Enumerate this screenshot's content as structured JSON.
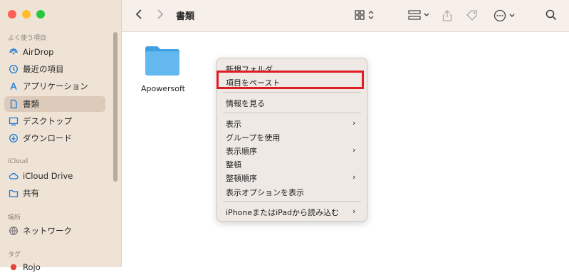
{
  "window": {
    "title": "書類"
  },
  "sidebar": {
    "sections": {
      "favorites": "よく使う項目",
      "icloud": "iCloud",
      "locations": "場所",
      "tags": "タグ"
    },
    "items": [
      {
        "label": "AirDrop",
        "icon": "airdrop-icon"
      },
      {
        "label": "最近の項目",
        "icon": "clock-icon"
      },
      {
        "label": "アプリケーション",
        "icon": "applications-icon"
      },
      {
        "label": "書類",
        "icon": "document-icon"
      },
      {
        "label": "デスクトップ",
        "icon": "desktop-icon"
      },
      {
        "label": "ダウンロード",
        "icon": "download-icon"
      },
      {
        "label": "iCloud Drive",
        "icon": "cloud-icon"
      },
      {
        "label": "共有",
        "icon": "shared-folder-icon"
      },
      {
        "label": "ネットワーク",
        "icon": "network-icon"
      },
      {
        "label": "Rojo",
        "icon": "tag-dot-icon"
      }
    ],
    "selected": "書類"
  },
  "content": {
    "folder_name": "Apowersoft"
  },
  "context_menu": {
    "items": [
      "新規フォルダ",
      "項目をペースト",
      "情報を見る",
      "表示",
      "グループを使用",
      "表示順序",
      "整頓",
      "整頓順序",
      "表示オプションを表示",
      "iPhoneまたはiPadから読み込む"
    ],
    "arrow": "›"
  },
  "colors": {
    "accent": "#1e7bd6",
    "highlight": "#e01b24",
    "folder": "#5fb3ec"
  }
}
